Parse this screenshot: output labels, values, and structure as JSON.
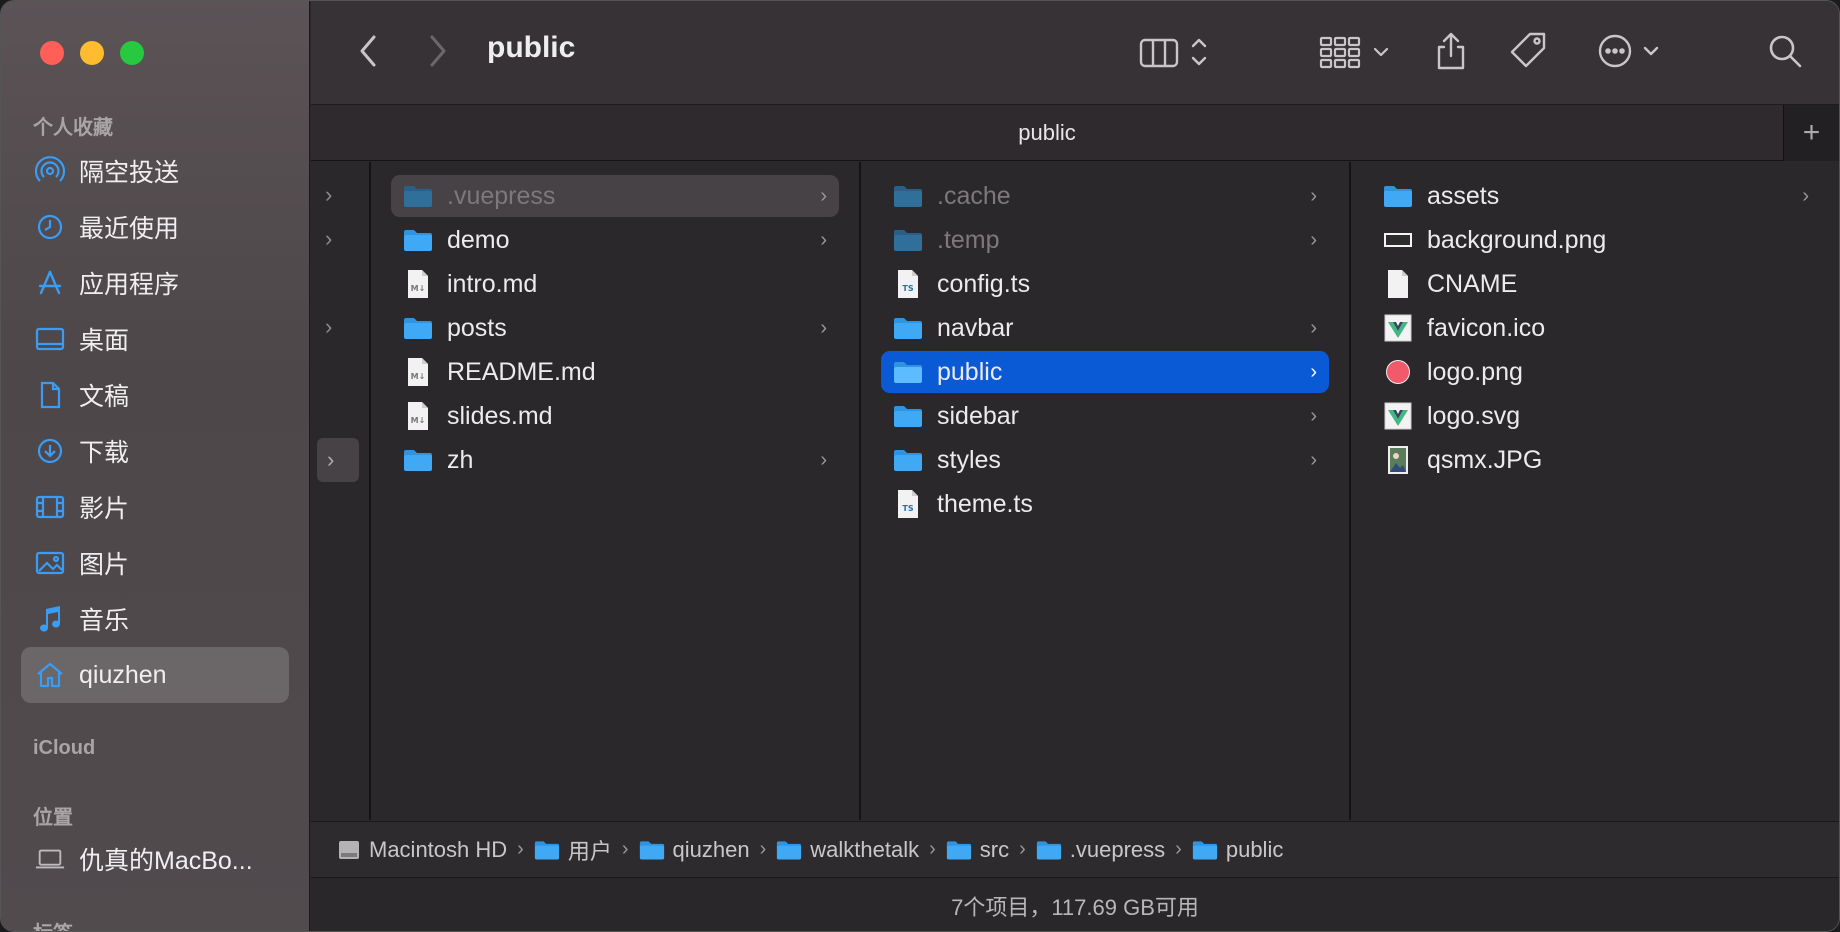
{
  "window": {
    "title": "public"
  },
  "sidebar": {
    "favorites_heading": "个人收藏",
    "favorites": [
      {
        "label": "隔空投送",
        "icon": "airdrop-icon"
      },
      {
        "label": "最近使用",
        "icon": "clock-icon"
      },
      {
        "label": "应用程序",
        "icon": "applications-icon"
      },
      {
        "label": "桌面",
        "icon": "desktop-icon"
      },
      {
        "label": "文稿",
        "icon": "document-icon"
      },
      {
        "label": "下载",
        "icon": "download-icon"
      },
      {
        "label": "影片",
        "icon": "film-icon"
      },
      {
        "label": "图片",
        "icon": "photo-icon"
      },
      {
        "label": "音乐",
        "icon": "music-icon"
      },
      {
        "label": "qiuzhen",
        "icon": "home-icon",
        "selected": true
      }
    ],
    "icloud_heading": "iCloud",
    "locations_heading": "位置",
    "locations": [
      {
        "label": "仇真的MacBo...",
        "icon": "laptop-icon"
      }
    ],
    "tags_heading": "标签"
  },
  "toolbar": {
    "title": "public",
    "back_icon": "chevron-left-icon",
    "forward_icon": "chevron-right-icon",
    "view_icon": "column-view-icon",
    "group_icon": "grid-group-icon",
    "share_icon": "share-icon",
    "tag_icon": "tag-icon",
    "more_icon": "ellipsis-circle-icon",
    "search_icon": "search-icon"
  },
  "tab": {
    "label": "public",
    "add_label": "+"
  },
  "columns": [
    {
      "items": [
        {
          "name": ".vuepress",
          "type": "folder",
          "dim": true,
          "selection": "inactive",
          "chevron": true
        },
        {
          "name": "demo",
          "type": "folder",
          "chevron": true
        },
        {
          "name": "intro.md",
          "type": "markdown"
        },
        {
          "name": "posts",
          "type": "folder",
          "chevron": true
        },
        {
          "name": "README.md",
          "type": "markdown"
        },
        {
          "name": "slides.md",
          "type": "markdown"
        },
        {
          "name": "zh",
          "type": "folder",
          "chevron": true
        }
      ]
    },
    {
      "items": [
        {
          "name": ".cache",
          "type": "folder",
          "dim": true,
          "chevron": true
        },
        {
          "name": ".temp",
          "type": "folder",
          "dim": true,
          "chevron": true
        },
        {
          "name": "config.ts",
          "type": "ts"
        },
        {
          "name": "navbar",
          "type": "folder",
          "chevron": true
        },
        {
          "name": "public",
          "type": "folder",
          "selection": "active",
          "chevron": true
        },
        {
          "name": "sidebar",
          "type": "folder",
          "chevron": true
        },
        {
          "name": "styles",
          "type": "folder",
          "chevron": true
        },
        {
          "name": "theme.ts",
          "type": "ts"
        }
      ]
    },
    {
      "items": [
        {
          "name": "assets",
          "type": "folder",
          "chevron": true
        },
        {
          "name": "background.png",
          "type": "image-bar"
        },
        {
          "name": "CNAME",
          "type": "blank"
        },
        {
          "name": "favicon.ico",
          "type": "vue-logo"
        },
        {
          "name": "logo.png",
          "type": "red-circle"
        },
        {
          "name": "logo.svg",
          "type": "vue-logo"
        },
        {
          "name": "qsmx.JPG",
          "type": "photo"
        }
      ]
    }
  ],
  "pathbar": [
    {
      "label": "Macintosh HD",
      "icon": "hard-drive-icon"
    },
    {
      "label": "用户",
      "icon": "folder-users-icon"
    },
    {
      "label": "qiuzhen",
      "icon": "folder-home-icon"
    },
    {
      "label": "walkthetalk",
      "icon": "folder-icon"
    },
    {
      "label": "src",
      "icon": "folder-icon"
    },
    {
      "label": ".vuepress",
      "icon": "folder-icon"
    },
    {
      "label": "public",
      "icon": "folder-icon"
    }
  ],
  "status": "7个项目，117.69 GB可用",
  "colors": {
    "accent": "#0a5ad6",
    "folder": "#3fa9f5",
    "sidebar_icon": "#3a9cf5"
  }
}
